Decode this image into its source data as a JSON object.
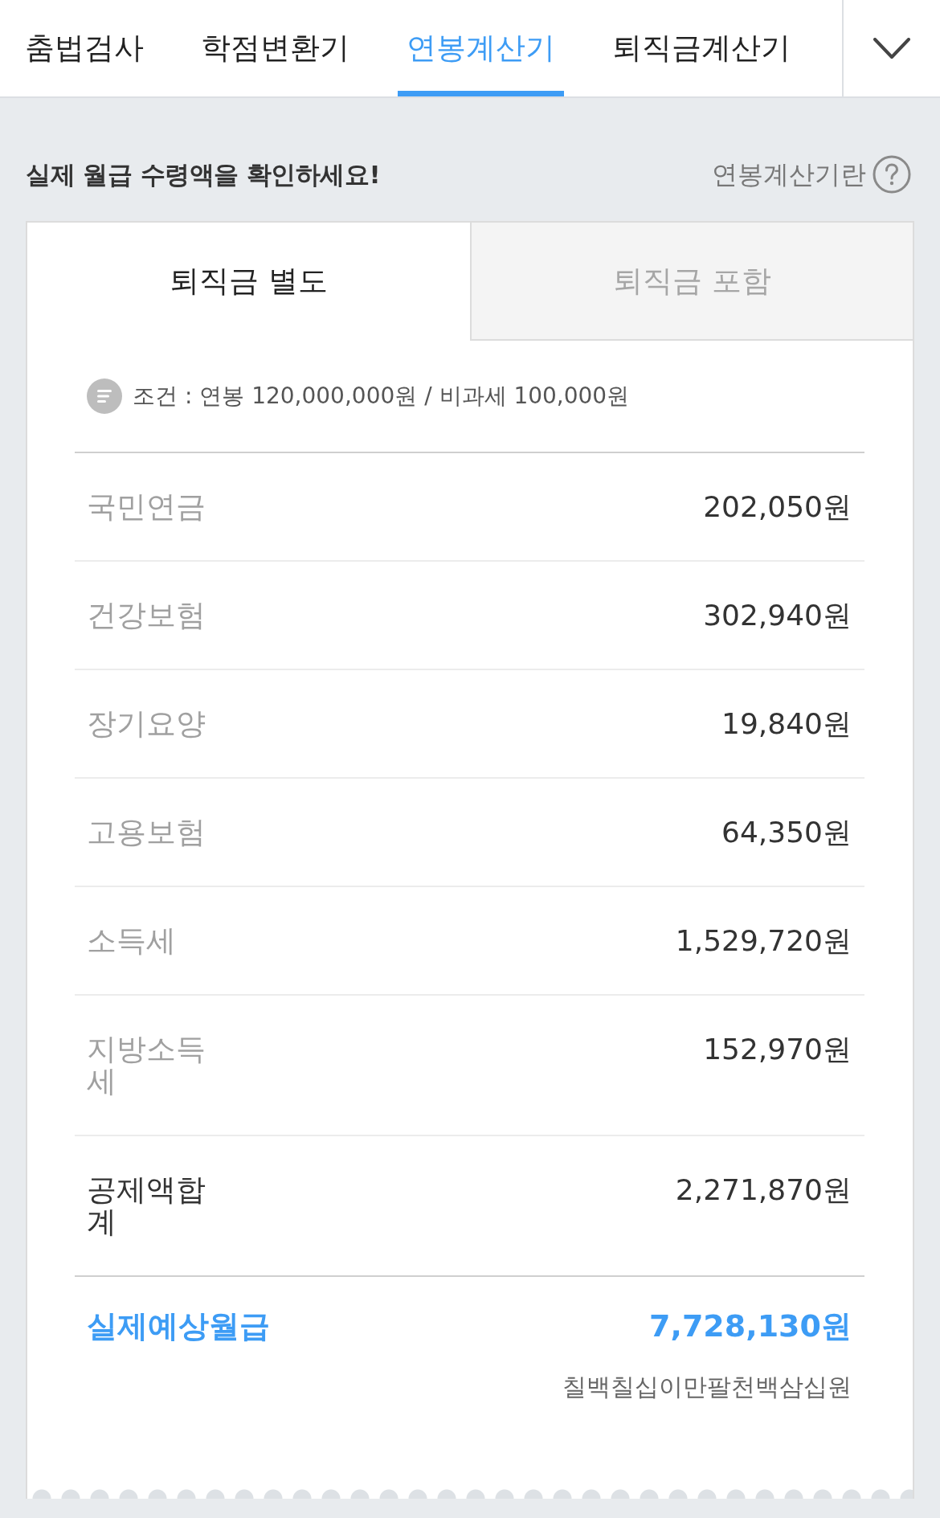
{
  "nav_tabs": [
    {
      "label": "춤법검사",
      "selected": false
    },
    {
      "label": "학점변환기",
      "selected": false
    },
    {
      "label": "연봉계산기",
      "selected": true
    },
    {
      "label": "퇴직금계산기",
      "selected": false
    }
  ],
  "header": {
    "title": "실제 월급 수령액을 확인하세요!",
    "help_link": "연봉계산기란"
  },
  "mode_tabs": [
    {
      "label": "퇴직금 별도",
      "selected": true
    },
    {
      "label": "퇴직금 포함",
      "selected": false
    }
  ],
  "condition": "조건 : 연봉 120,000,000원 / 비과세 100,000원",
  "deductions": [
    {
      "label": "국민연금",
      "value": "202,050원"
    },
    {
      "label": "건강보험",
      "value": "302,940원"
    },
    {
      "label": "장기요양",
      "value": "19,840원"
    },
    {
      "label": "고용보험",
      "value": "64,350원"
    },
    {
      "label": "소득세",
      "value": "1,529,720원"
    },
    {
      "label": "지방소득세",
      "value": "152,970원"
    }
  ],
  "deduction_total": {
    "label": "공제액합계",
    "value": "2,271,870원"
  },
  "net_pay": {
    "label": "실제예상월급",
    "value": "7,728,130원",
    "in_words": "칠백칠십이만팔천백삼십원"
  }
}
